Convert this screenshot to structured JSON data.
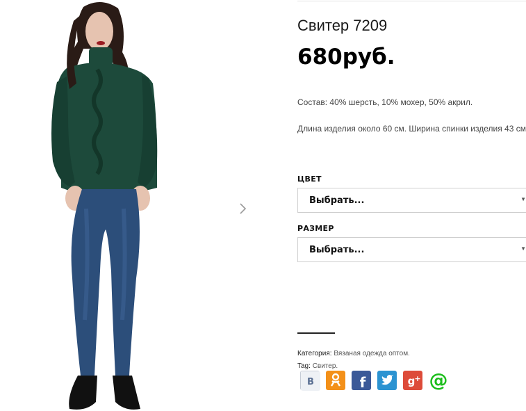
{
  "product": {
    "title": "Свитер 7209",
    "price": "680руб.",
    "composition": "Состав: 40% шерсть, 10% мохер, 50% акрил.",
    "dimensions": "Длина изделия около 60 см. Ширина спинки изделия 43 см."
  },
  "options": [
    {
      "label": "ЦВЕТ",
      "selected": "Выбрать..."
    },
    {
      "label": "РАЗМЕР",
      "selected": "Выбрать..."
    }
  ],
  "meta": {
    "category_label": "Категория:",
    "category_value": "Вязаная одежда оптом.",
    "tag_label": "Tag:",
    "tag_value": "Свитер."
  },
  "share": [
    {
      "icon": "vkontakte-icon",
      "glyph": "B",
      "color": "#e8ecf1"
    },
    {
      "icon": "odnoklassniki-icon",
      "glyph": "ok",
      "color": "#f39019"
    },
    {
      "icon": "facebook-icon",
      "glyph": "f",
      "color": "#3b5998"
    },
    {
      "icon": "twitter-icon",
      "glyph": "t",
      "color": "#2b93d1"
    },
    {
      "icon": "google-plus-icon",
      "glyph": "g+",
      "color": "#dd4b39"
    },
    {
      "icon": "mailru-icon",
      "glyph": "@",
      "color": "#1bbd1b"
    }
  ],
  "gallery": {
    "next_glyph": "›"
  },
  "colors": {
    "sweater": "#1d4a3b",
    "jeans": "#2c4e7a",
    "hair": "#2a1b16",
    "skin": "#e6c3b0"
  }
}
